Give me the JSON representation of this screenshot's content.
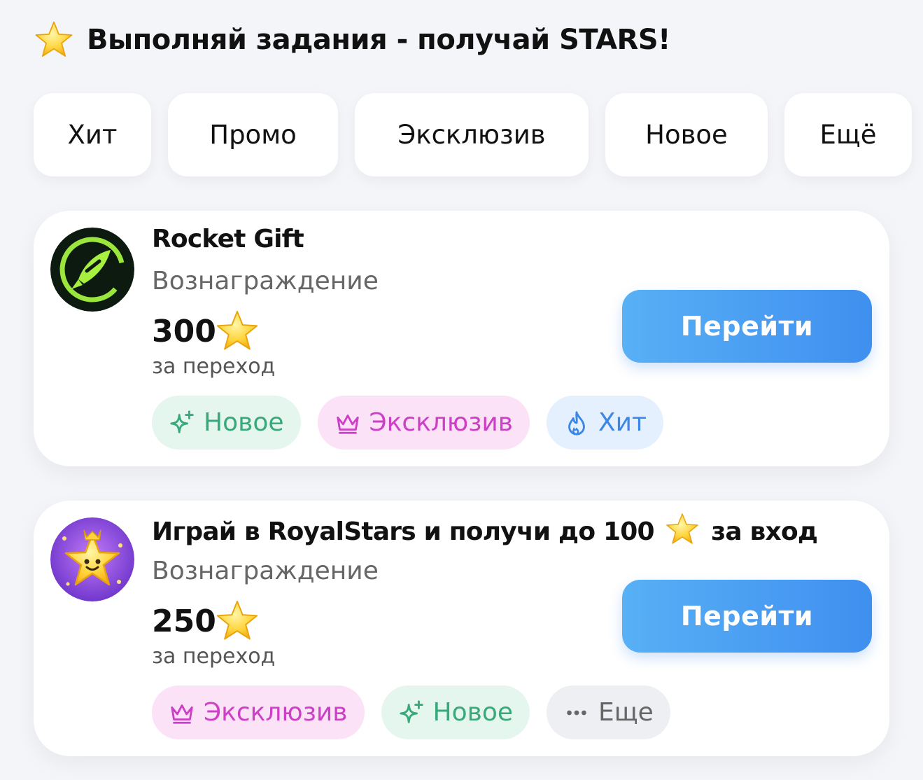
{
  "header": {
    "title": "Выполняй задания - получай STARS!",
    "icon": "star-icon"
  },
  "filters": [
    {
      "label": "Хит",
      "width": 168
    },
    {
      "label": "Промо",
      "width": 243
    },
    {
      "label": "Эксклюзив",
      "width": 334
    },
    {
      "label": "Новое",
      "width": 232
    },
    {
      "label": "Ещё",
      "width": 182
    }
  ],
  "tasks": [
    {
      "title": "Rocket Gift",
      "reward_label": "Вознаграждение",
      "amount": "300",
      "per": "за переход",
      "button": "Перейти",
      "tags": [
        {
          "label": "Новое",
          "kind": "new",
          "icon": "sparkle-icon"
        },
        {
          "label": "Эксклюзив",
          "kind": "excl",
          "icon": "crown-icon"
        },
        {
          "label": "Хит",
          "kind": "hit",
          "icon": "flame-icon"
        }
      ]
    },
    {
      "title_before": "Играй в RoyalStars и получи до 100",
      "title_after": "за вход",
      "reward_label": "Вознаграждение",
      "amount": "250",
      "per": "за переход",
      "button": "Перейти",
      "tags": [
        {
          "label": "Эксклюзив",
          "kind": "excl",
          "icon": "crown-icon"
        },
        {
          "label": "Новое",
          "kind": "new",
          "icon": "sparkle-icon"
        },
        {
          "label": "Еще",
          "kind": "more",
          "icon": "dots-icon"
        }
      ]
    }
  ],
  "colors": {
    "accent": "#3f8ff0",
    "new": "#37a97a",
    "excl": "#cc3fc6",
    "hit": "#3b86e6"
  }
}
